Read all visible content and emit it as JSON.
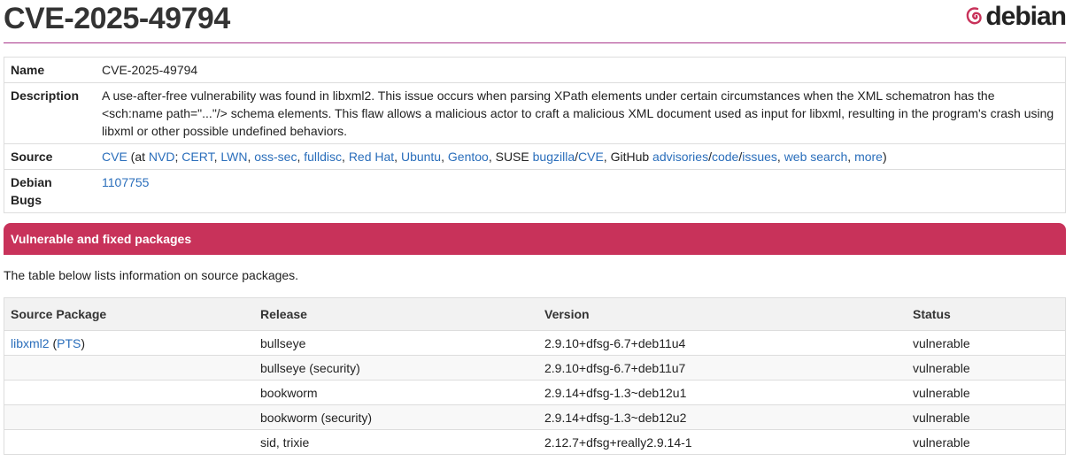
{
  "page": {
    "title": "CVE-2025-49794",
    "logo_text": "debian",
    "logo_icon": "debian-swirl-icon"
  },
  "colors": {
    "accent": "#c8325a",
    "link": "#2a6ebb",
    "vulnerable": "#e0321e",
    "header_rule": "#a8368a"
  },
  "info": {
    "name_label": "Name",
    "name_value": "CVE-2025-49794",
    "description_label": "Description",
    "description_value": "A use-after-free vulnerability was found in libxml2. This issue occurs when parsing XPath elements under certain circumstances when the XML schematron has the <sch:name path=\"...\"/> schema elements. This flaw allows a malicious actor to craft a malicious XML document used as input for libxml, resulting in the program's crash using libxml or other possible undefined behaviors.",
    "source_label": "Source",
    "source": {
      "cve": "CVE",
      "at_open": " (at ",
      "nvd": "NVD",
      "sep1": "; ",
      "cert": "CERT",
      "c1": ", ",
      "lwn": "LWN",
      "c2": ", ",
      "osssec": "oss-sec",
      "c3": ", ",
      "fulldisc": "fulldisc",
      "c4": ", ",
      "redhat": "Red Hat",
      "c5": ", ",
      "ubuntu": "Ubuntu",
      "c6": ", ",
      "gentoo": "Gentoo",
      "suse_prefix": ", SUSE ",
      "bugzilla": "bugzilla",
      "slash1": "/",
      "suse_cve": "CVE",
      "github_prefix": ", GitHub ",
      "advisories": "advisories",
      "slash2": "/",
      "code": "code",
      "slash3": "/",
      "issues": "issues",
      "c7": ", ",
      "websearch": "web search",
      "c8": ", ",
      "more": "more",
      "close": ")"
    },
    "bugs_label_line1": "Debian",
    "bugs_label_line2": "Bugs",
    "bugs_value": "1107755"
  },
  "section": {
    "title": "Vulnerable and fixed packages"
  },
  "intro_text": "The table below lists information on source packages.",
  "packages": {
    "headers": [
      "Source Package",
      "Release",
      "Version",
      "Status"
    ],
    "package_name": "libxml2",
    "pts_open": " (",
    "pts_link": "PTS",
    "pts_close": ")",
    "rows": [
      {
        "release": "bullseye",
        "version": "2.9.10+dfsg-6.7+deb11u4",
        "status": "vulnerable"
      },
      {
        "release": "bullseye (security)",
        "version": "2.9.10+dfsg-6.7+deb11u7",
        "status": "vulnerable"
      },
      {
        "release": "bookworm",
        "version": "2.9.14+dfsg-1.3~deb12u1",
        "status": "vulnerable"
      },
      {
        "release": "bookworm (security)",
        "version": "2.9.14+dfsg-1.3~deb12u2",
        "status": "vulnerable"
      },
      {
        "release": "sid, trixie",
        "version": "2.12.7+dfsg+really2.9.14-1",
        "status": "vulnerable"
      }
    ]
  }
}
